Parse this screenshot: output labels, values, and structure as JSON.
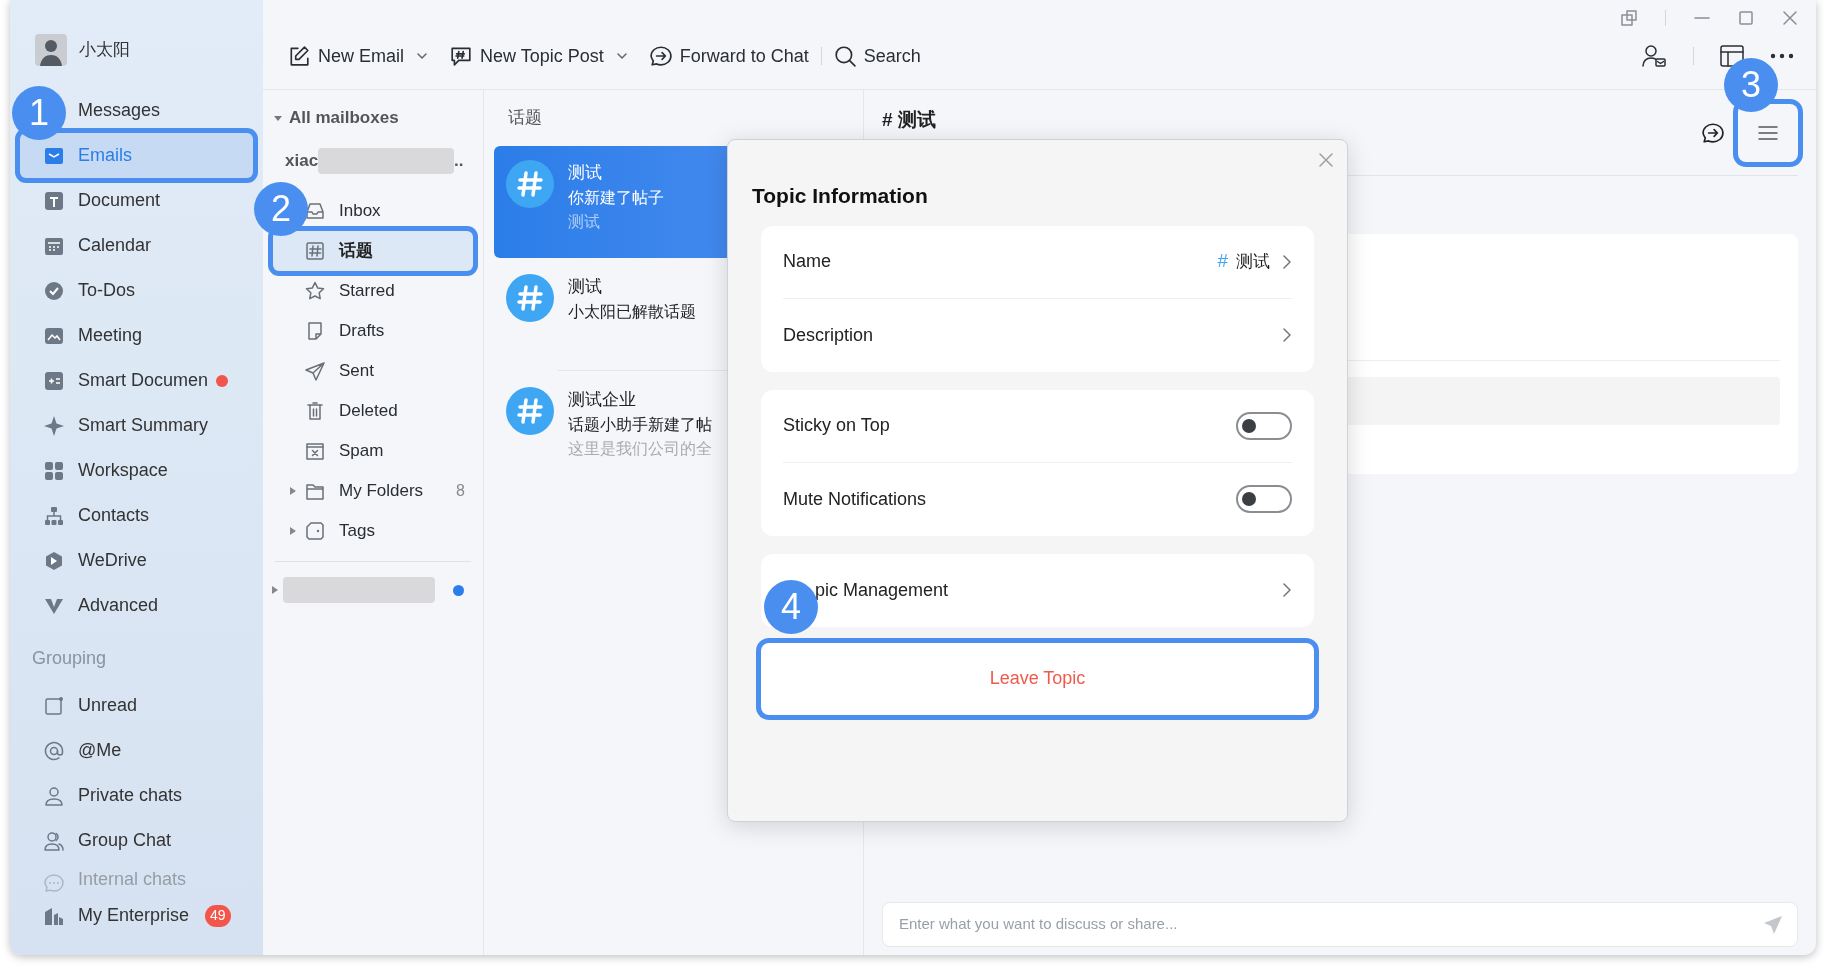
{
  "user": {
    "name": "小太阳"
  },
  "nav": [
    {
      "label": "Messages",
      "selected": false,
      "dot": false
    },
    {
      "label": "Emails",
      "selected": true,
      "dot": false
    },
    {
      "label": "Document",
      "selected": false,
      "dot": false
    },
    {
      "label": "Calendar",
      "selected": false,
      "dot": false
    },
    {
      "label": "To-Dos",
      "selected": false,
      "dot": false
    },
    {
      "label": "Meeting",
      "selected": false,
      "dot": false
    },
    {
      "label": "Smart Documen",
      "selected": false,
      "dot": true
    },
    {
      "label": "Smart Summary",
      "selected": false,
      "dot": false
    },
    {
      "label": "Workspace",
      "selected": false,
      "dot": false
    },
    {
      "label": "Contacts",
      "selected": false,
      "dot": false
    },
    {
      "label": "WeDrive",
      "selected": false,
      "dot": false
    },
    {
      "label": "Advanced",
      "selected": false,
      "dot": false
    }
  ],
  "grouping": {
    "title": "Grouping",
    "items": [
      {
        "label": "Unread"
      },
      {
        "label": "@Me"
      },
      {
        "label": "Private chats"
      },
      {
        "label": "Group Chat"
      },
      {
        "label": "Internal chats"
      }
    ]
  },
  "enterprise": {
    "label": "My Enterprise",
    "badge": "49"
  },
  "toolbar": [
    {
      "label": "New Email",
      "dropdown": true
    },
    {
      "label": "New Topic Post",
      "dropdown": true
    },
    {
      "label": "Forward to Chat",
      "dropdown": false
    },
    {
      "label": "Search",
      "dropdown": false
    }
  ],
  "mailboxes": {
    "title": "All mailboxes",
    "expanded": true,
    "account": "xiac",
    "account_suffix": "..",
    "folders": [
      {
        "label": "Inbox",
        "selected": false,
        "expandable": false
      },
      {
        "label": "话题",
        "selected": true,
        "expandable": false
      },
      {
        "label": "Starred",
        "selected": false,
        "expandable": false
      },
      {
        "label": "Drafts",
        "selected": false,
        "expandable": false
      },
      {
        "label": "Sent",
        "selected": false,
        "expandable": false
      },
      {
        "label": "Deleted",
        "selected": false,
        "expandable": false
      },
      {
        "label": "Spam",
        "selected": false,
        "expandable": false
      },
      {
        "label": "My Folders",
        "selected": false,
        "expandable": true,
        "count": "8"
      },
      {
        "label": "Tags",
        "selected": false,
        "expandable": true
      }
    ],
    "second_account": {
      "unread": true
    }
  },
  "topics": {
    "title": "话题",
    "items": [
      {
        "title": "测试",
        "lines": [
          "你新建了帖子",
          "测试"
        ],
        "selected": true
      },
      {
        "title": "测试",
        "lines": [
          "小太阳已解散话题"
        ],
        "selected": false
      },
      {
        "title": "测试企业",
        "lines": [
          "话题小助手新建了帖",
          "这里是我们公司的全"
        ],
        "selected": false
      }
    ]
  },
  "chat": {
    "title": "# 测试",
    "placeholder": "Enter what you want to discuss or share..."
  },
  "dialog": {
    "title": "Topic Information",
    "groups": [
      [
        {
          "kind": "link",
          "label": "Name",
          "tag": "#",
          "value": "测试"
        },
        {
          "kind": "link",
          "label": "Description"
        }
      ],
      [
        {
          "kind": "toggle",
          "label": "Sticky on Top",
          "on": false
        },
        {
          "kind": "toggle",
          "label": "Mute Notifications",
          "on": false
        }
      ],
      [
        {
          "kind": "link",
          "label": "pic Management"
        }
      ]
    ],
    "leave_button": "Leave Topic"
  },
  "annotations": [
    {
      "number": "1"
    },
    {
      "number": "2"
    },
    {
      "number": "3"
    },
    {
      "number": "4"
    }
  ]
}
